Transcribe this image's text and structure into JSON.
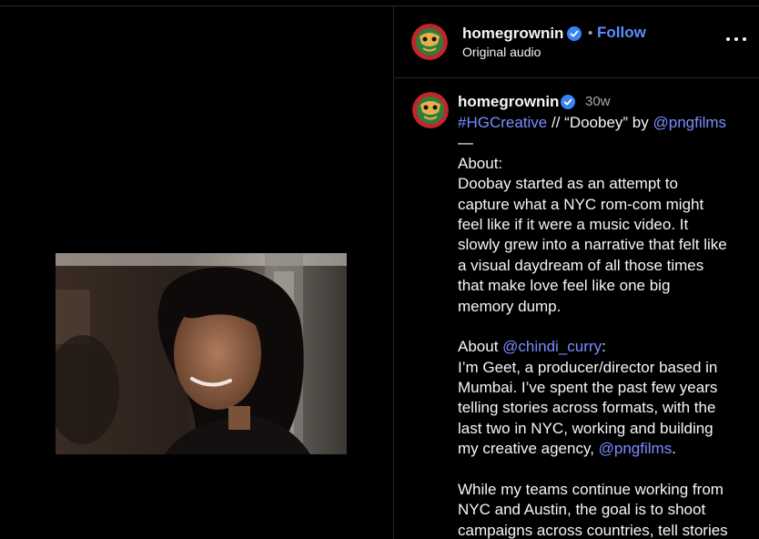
{
  "header": {
    "username": "homegrownin",
    "separator": "•",
    "follow_label": "Follow",
    "audio_label": "Original audio",
    "more_icon": "more-horizontal-icon"
  },
  "comment": {
    "username": "homegrownin",
    "time": "30w",
    "lines": [
      [
        {
          "t": "#HGCreative",
          "link": true
        },
        {
          "t": " // “Doobey” by "
        },
        {
          "t": "@pngfilms",
          "link": true
        }
      ],
      [
        {
          "t": "—"
        }
      ],
      [
        {
          "t": "About:"
        }
      ],
      [
        {
          "t": "Doobay started as an attempt to"
        }
      ],
      [
        {
          "t": "capture what a NYC rom-com might"
        }
      ],
      [
        {
          "t": "feel like if it were a music video. It"
        }
      ],
      [
        {
          "t": "slowly grew into a narrative that felt like"
        }
      ],
      [
        {
          "t": "a visual daydream of all those times"
        }
      ],
      [
        {
          "t": "that make love feel like one big"
        }
      ],
      [
        {
          "t": "memory dump."
        }
      ],
      [
        {
          "t": ""
        }
      ],
      [
        {
          "t": "About "
        },
        {
          "t": "@chindi_curry",
          "link": true
        },
        {
          "t": ":"
        }
      ],
      [
        {
          "t": "I’m Geet, a producer/director based in"
        }
      ],
      [
        {
          "t": "Mumbai. I’ve spent the past few years"
        }
      ],
      [
        {
          "t": "telling stories across formats, with the"
        }
      ],
      [
        {
          "t": "last two in NYC, working and building"
        }
      ],
      [
        {
          "t": "my creative agency, "
        },
        {
          "t": "@pngfilms",
          "link": true
        },
        {
          "t": "."
        }
      ],
      [
        {
          "t": ""
        }
      ],
      [
        {
          "t": "While my teams continue working from"
        }
      ],
      [
        {
          "t": "NYC and Austin, the goal is to shoot"
        }
      ],
      [
        {
          "t": "campaigns across countries, tell stories"
        }
      ]
    ]
  },
  "colors": {
    "background": "#000000",
    "link": "#7b8cff",
    "follow": "#5b8cff",
    "verified": "#3b82f6",
    "muted": "#a8a8a8"
  }
}
